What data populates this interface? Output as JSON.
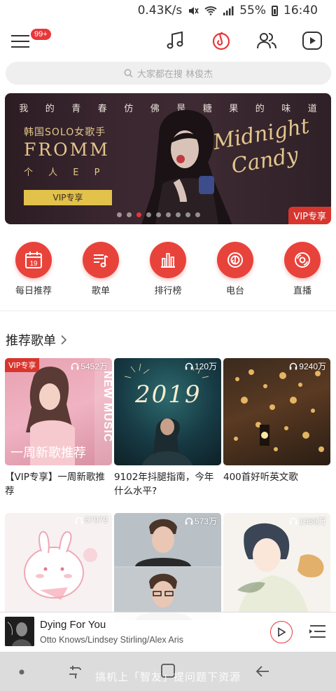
{
  "status": {
    "speed": "0.43K/s",
    "battery": "55%",
    "time": "16:40"
  },
  "nav": {
    "badge": "99+",
    "icons": [
      "menu-icon",
      "music-icon",
      "netease-cloud-icon",
      "friends-icon",
      "video-icon"
    ],
    "active": "netease-cloud-icon"
  },
  "search": {
    "placeholder": "大家都在搜 林俊杰"
  },
  "banner": {
    "slogan": [
      "我",
      "的",
      "青",
      "春",
      "仿",
      "佛",
      "是",
      "糖",
      "果",
      "的",
      "味",
      "道"
    ],
    "line1": "韩国SOLO女歌手",
    "line2": "FROMM",
    "line3": "个 人 E P",
    "button": "VIP专享",
    "script1": "Midnight",
    "script2": "Candy",
    "corner_badge": "VIP专享",
    "active_dot": 3,
    "dot_count": 9
  },
  "quick_entries": [
    {
      "label": "每日推荐",
      "icon": "calendar-icon",
      "day": "19"
    },
    {
      "label": "歌单",
      "icon": "playlist-icon"
    },
    {
      "label": "排行榜",
      "icon": "chart-icon"
    },
    {
      "label": "电台",
      "icon": "radio-icon"
    },
    {
      "label": "直播",
      "icon": "live-icon"
    }
  ],
  "section": {
    "title": "推荐歌单"
  },
  "playlists": [
    {
      "title": "【VIP专享】一周新歌推荐",
      "plays": "5452万",
      "vip": "VIP专享",
      "overlay": "一周新歌推荐",
      "side": "NEW MUSIC"
    },
    {
      "title": "9102年抖腿指南，今年什么水平?",
      "plays": "120万",
      "overlay": "2019"
    },
    {
      "title": "400首好听英文歌",
      "plays": "9240万"
    },
    {
      "title": "",
      "plays": "67979"
    },
    {
      "title": "",
      "plays": "573万"
    },
    {
      "title": "",
      "plays": "1968万"
    }
  ],
  "player": {
    "song": "Dying For You",
    "artist": "Otto Knows/Lindsey Stirling/Alex Aris"
  },
  "watermark": "搞机上「智友」提问题下资源",
  "colors": {
    "accent": "#e8373a",
    "gold": "#e3c68c"
  }
}
